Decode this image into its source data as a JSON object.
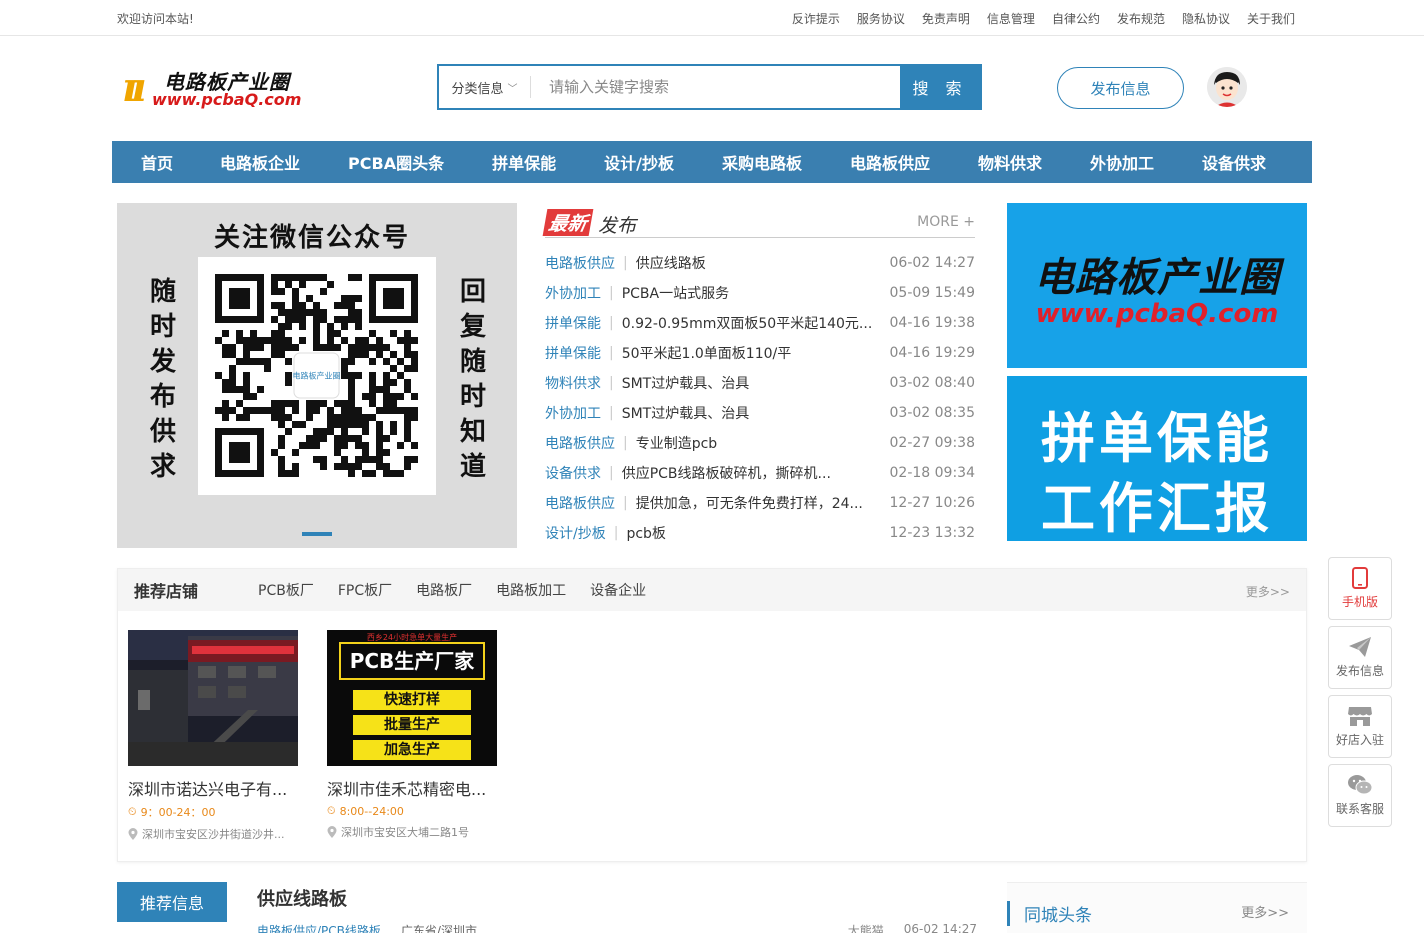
{
  "topbar": {
    "welcome": "欢迎访问本站!",
    "links": [
      "反诈提示",
      "服务协议",
      "免责声明",
      "信息管理",
      "自律公约",
      "发布规范",
      "隐私协议",
      "关于我们"
    ]
  },
  "header": {
    "logo_cn": "电路板产业圈",
    "logo_url": "www.pcbaQ.com",
    "search_category": "分类信息",
    "search_placeholder": "请输入关键字搜索",
    "search_button": "搜 索",
    "publish_button": "发布信息"
  },
  "nav": [
    "首页",
    "电路板企业",
    "PCBA圈头条",
    "拼单保能",
    "设计/抄板",
    "采购电路板",
    "电路板供应",
    "物料供求",
    "外协加工",
    "设备供求"
  ],
  "qr_banner": {
    "title": "关注微信公众号",
    "left_text": "随时发布供求",
    "right_text": "回复随时知道",
    "center_logo": "电路板产业圈 PCBAQ.com"
  },
  "latest": {
    "tag": "最新",
    "heading": "发布",
    "more": "MORE +",
    "items": [
      {
        "cat": "电路板供应",
        "title": "供应线路板",
        "date": "06-02 14:27"
      },
      {
        "cat": "外协加工",
        "title": "PCBA一站式服务",
        "date": "05-09 15:49"
      },
      {
        "cat": "拼单保能",
        "title": "0.92-0.95mm双面板50平米起140元...",
        "date": "04-16 19:38"
      },
      {
        "cat": "拼单保能",
        "title": "50平米起1.0单面板110/平",
        "date": "04-16 19:29"
      },
      {
        "cat": "物料供求",
        "title": "SMT过炉载具、治具",
        "date": "03-02 08:40"
      },
      {
        "cat": "外协加工",
        "title": "SMT过炉载具、治具",
        "date": "03-02 08:35"
      },
      {
        "cat": "电路板供应",
        "title": "专业制造pcb",
        "date": "02-27 09:38"
      },
      {
        "cat": "设备供求",
        "title": "供应PCB线路板破碎机，撕碎机...",
        "date": "02-18 09:34"
      },
      {
        "cat": "电路板供应",
        "title": "提供加急，可无条件免费打样，24...",
        "date": "12-27 10:26"
      },
      {
        "cat": "设计/抄板",
        "title": "pcb板",
        "date": "12-23 13:32"
      }
    ]
  },
  "ads": {
    "ad1_title": "电路板产业圈",
    "ad1_url": "www.pcbaQ.com",
    "ad2_line1": "拼单保能",
    "ad2_line2": "工作汇报"
  },
  "shops": {
    "title": "推荐店铺",
    "tabs": [
      "PCB板厂",
      "FPC板厂",
      "电路板厂",
      "电路板加工",
      "设备企业"
    ],
    "more": "更多>>",
    "items": [
      {
        "name": "深圳市诺达兴电子有...",
        "hours": "9：00-24：00",
        "addr": "深圳市宝安区沙井街道沙井..."
      },
      {
        "name": "深圳市佳禾芯精密电...",
        "hours": "8:00--24:00",
        "addr": "深圳市宝安区大埔二路1号",
        "img_top": "西乡24小时急单大量生产",
        "img_title": "PCB生产厂家",
        "img_lines": [
          "快速打样",
          "批量生产",
          "加急生产"
        ]
      }
    ]
  },
  "float": [
    "手机版",
    "发布信息",
    "好店入驻",
    "联系客服"
  ],
  "bottom": {
    "rec_button": "推荐信息",
    "rec_title": "供应线路板",
    "rec_cat": "电路板供应/PCB线路板",
    "rec_place": "广东省/深圳市",
    "rec_user": "大熊猫",
    "rec_date": "06-02 14:27",
    "city_title": "同城头条",
    "city_more": "更多>>"
  },
  "colors": {
    "primary": "#2f83b8",
    "nav": "#3a7fb0",
    "accent_red": "#e23b3b",
    "ad_blue": "#17a2e8"
  }
}
